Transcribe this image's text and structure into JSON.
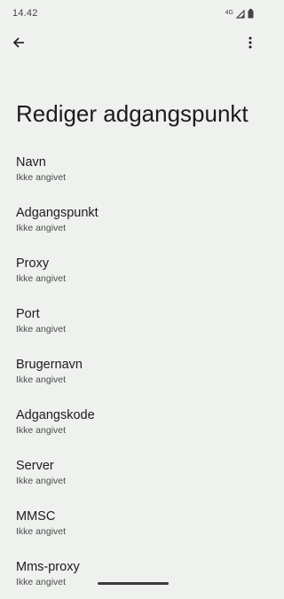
{
  "status_bar": {
    "time": "14.42",
    "network_type": "4G"
  },
  "toolbar": {
    "back_icon": "arrow-back-icon",
    "menu_icon": "more-vert-icon"
  },
  "page": {
    "title": "Rediger adgangspunkt"
  },
  "settings": [
    {
      "title": "Navn",
      "summary": "Ikke angivet"
    },
    {
      "title": "Adgangspunkt",
      "summary": "Ikke angivet"
    },
    {
      "title": "Proxy",
      "summary": "Ikke angivet"
    },
    {
      "title": "Port",
      "summary": "Ikke angivet"
    },
    {
      "title": "Brugernavn",
      "summary": "Ikke angivet"
    },
    {
      "title": "Adgangskode",
      "summary": "Ikke angivet"
    },
    {
      "title": "Server",
      "summary": "Ikke angivet"
    },
    {
      "title": "MMSC",
      "summary": "Ikke angivet"
    },
    {
      "title": "Mms-proxy",
      "summary": "Ikke angivet"
    }
  ]
}
